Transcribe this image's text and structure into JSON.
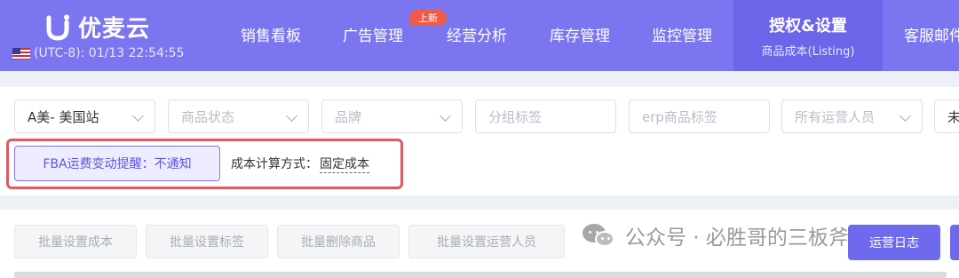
{
  "brand": {
    "name": "优麦云"
  },
  "clock": {
    "text": "(UTC-8): 01/13 22:54:55"
  },
  "nav": {
    "items": [
      {
        "label": "销售看板"
      },
      {
        "label": "广告管理"
      },
      {
        "label": "经营分析"
      },
      {
        "label": "库存管理"
      },
      {
        "label": "监控管理"
      },
      {
        "label": "授权&设置",
        "sub": "商品成本(Listing)"
      },
      {
        "label": "客服邮件"
      }
    ],
    "badge": "上新"
  },
  "filters": {
    "site": "A美- 美国站",
    "status_placeholder": "商品状态",
    "brand_placeholder": "品牌",
    "group_placeholder": "分组标签",
    "erp_placeholder": "erp商品标签",
    "operator_placeholder": "所有运营人员",
    "last_partial": "未"
  },
  "fba": {
    "label": "FBA运费变动提醒：不通知"
  },
  "cost": {
    "label": "成本计算方式：",
    "value": "固定成本"
  },
  "actions": {
    "set_cost": "批量设置成本",
    "set_tags": "批量设置标签",
    "delete": "批量删除商品",
    "set_operator": "批量设置运营人员",
    "log": "运营日志"
  },
  "watermark": {
    "text": "公众号 · 必胜哥的三板斧"
  },
  "colors": {
    "primary": "#7b76f0",
    "highlight": "#dd5a60",
    "badge": "#ee5b46"
  }
}
